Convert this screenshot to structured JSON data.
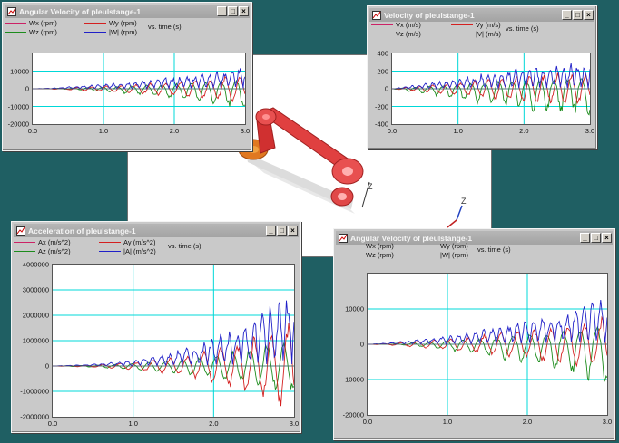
{
  "colors": {
    "x": "#cc2266",
    "y": "#d42020",
    "z": "#1c8c1c",
    "mag": "#2020c8",
    "grid": "#00d8d8",
    "zero": "#606060"
  },
  "icons": {
    "window": "chart-window-icon",
    "minimize": "minimize-icon",
    "maximize": "maximize-icon",
    "close": "close-icon"
  },
  "model": {
    "axis_z": "Z"
  },
  "windows": [
    {
      "id": "angvel-top",
      "title": "Angular Velocity of pleulstange-1",
      "legend": [
        "Wx (rpm)",
        "Wy (rpm)",
        "Wz (rpm)",
        "|W| (rpm)"
      ],
      "vs_label": "vs. time (s)",
      "yticks": [
        "10000",
        "0",
        "-10000",
        "-20000"
      ],
      "xticks": [
        "0.0",
        "1.0",
        "2.0",
        "3.0"
      ],
      "buttons": {
        "minimize": "_",
        "maximize": "□",
        "close": "×"
      },
      "chart_data": {
        "type": "line",
        "title": "Angular Velocity of pleulstange-1",
        "xlabel": "time (s)",
        "ylabel": "",
        "xlim": [
          0,
          3
        ],
        "ylim": [
          -20000,
          20000
        ],
        "grid": true,
        "series": [
          {
            "name": "Wx (rpm)",
            "values_desc": ""
          },
          {
            "name": "Wy (rpm)"
          },
          {
            "name": "Wz (rpm)",
            "values": [
              0,
              0,
              -500,
              -1500,
              -2500,
              -3500,
              -5000,
              -6500,
              -8000,
              -10000,
              -11500,
              -13000
            ],
            "x": [
              0,
              0.3,
              0.6,
              0.9,
              1.2,
              1.5,
              1.8,
              2.1,
              2.4,
              2.6,
              2.8,
              3.0
            ]
          },
          {
            "name": "|W| (rpm)",
            "values": [
              0,
              500,
              1500,
              2500,
              3500,
              5000,
              6500,
              8000,
              9500,
              11000,
              12500,
              14000
            ],
            "x": [
              0,
              0.3,
              0.6,
              0.9,
              1.2,
              1.5,
              1.8,
              2.1,
              2.4,
              2.6,
              2.8,
              3.0
            ]
          }
        ]
      }
    },
    {
      "id": "vel-top",
      "title": "Velocity of pleulstange-1",
      "legend": [
        "Vx (m/s)",
        "Vy (m/s)",
        "Vz (m/s)",
        "|V| (m/s)"
      ],
      "vs_label": "vs. time (s)",
      "yticks": [
        "400",
        "200",
        "0",
        "-200",
        "-400"
      ],
      "xticks": [
        "0.0",
        "1.0",
        "2.0",
        "3.0"
      ],
      "buttons": {
        "minimize": "_",
        "maximize": "□",
        "close": "×"
      },
      "chart_data": {
        "type": "line",
        "title": "Velocity of pleulstange-1",
        "xlabel": "time (s)",
        "ylabel": "",
        "xlim": [
          0,
          3
        ],
        "ylim": [
          -400,
          400
        ],
        "grid": true,
        "series": [
          {
            "name": "Vx (m/s)"
          },
          {
            "name": "Vy (m/s)",
            "values": [
              0,
              -40,
              -80,
              -120,
              -160,
              -200,
              -240,
              -270,
              -300,
              -320
            ],
            "x": [
              0,
              0.3,
              0.6,
              0.9,
              1.2,
              1.5,
              1.8,
              2.1,
              2.5,
              3.0
            ]
          },
          {
            "name": "Vz (m/s)",
            "values": [
              0,
              -30,
              -60,
              -100,
              -140,
              -170,
              -200,
              -230,
              -260,
              -280
            ],
            "x": [
              0,
              0.3,
              0.6,
              0.9,
              1.2,
              1.5,
              1.8,
              2.1,
              2.5,
              3.0
            ]
          },
          {
            "name": "|V| (m/s)",
            "values": [
              0,
              40,
              80,
              120,
              160,
              200,
              240,
              270,
              300,
              320
            ],
            "x": [
              0,
              0.3,
              0.6,
              0.9,
              1.2,
              1.5,
              1.8,
              2.1,
              2.5,
              3.0
            ]
          }
        ]
      }
    },
    {
      "id": "acc-bottom",
      "title": "Acceleration of pleulstange-1",
      "legend": [
        "Ax (m/s^2)",
        "Ay (m/s^2)",
        "Az (m/s^2)",
        "|A| (m/s^2)"
      ],
      "vs_label": "vs. time (s)",
      "yticks": [
        "4000000",
        "3000000",
        "2000000",
        "1000000",
        "0",
        "-1000000",
        "-2000000"
      ],
      "xticks": [
        "0.0",
        "1.0",
        "2.0",
        "3.0"
      ],
      "buttons": {
        "minimize": "_",
        "maximize": "□",
        "close": "×"
      },
      "chart_data": {
        "type": "line",
        "title": "Acceleration of pleulstange-1",
        "xlabel": "time (s)",
        "ylabel": "",
        "xlim": [
          0,
          3
        ],
        "ylim": [
          -2000000,
          4000000
        ],
        "grid": true,
        "series": [
          {
            "name": "Ax (m/s^2)"
          },
          {
            "name": "Ay (m/s^2)",
            "values": [
              0,
              -50000,
              -150000,
              -300000,
              -500000,
              -700000,
              -900000,
              -1100000
            ],
            "x": [
              0,
              0.5,
              1.0,
              1.5,
              2.0,
              2.4,
              2.7,
              3.0
            ]
          },
          {
            "name": "Az (m/s^2)",
            "values": [
              0,
              -50000,
              -150000,
              -300000,
              -550000,
              -800000,
              -1000000,
              -1200000
            ],
            "x": [
              0,
              0.5,
              1.0,
              1.5,
              2.0,
              2.4,
              2.7,
              3.0
            ]
          },
          {
            "name": "|A| (m/s^2)",
            "values": [
              0,
              80000,
              250000,
              600000,
              1200000,
              1900000,
              2600000,
              3400000
            ],
            "x": [
              0,
              0.5,
              1.0,
              1.5,
              2.0,
              2.4,
              2.7,
              3.0
            ]
          }
        ]
      }
    },
    {
      "id": "angvel-bottom",
      "title": "Angular Velocity of pleulstange-1",
      "legend": [
        "Wx (rpm)",
        "Wy (rpm)",
        "Wz (rpm)",
        "|W| (rpm)"
      ],
      "vs_label": "vs. time (s)",
      "yticks": [
        "10000",
        "0",
        "-10000",
        "-20000"
      ],
      "xticks": [
        "0.0",
        "1.0",
        "2.0",
        "3.0"
      ],
      "buttons": {
        "minimize": "_",
        "maximize": "□",
        "close": "×"
      },
      "chart_data": {
        "type": "line",
        "title": "Angular Velocity of pleulstange-1",
        "xlabel": "time (s)",
        "ylabel": "",
        "xlim": [
          0,
          3
        ],
        "ylim": [
          -20000,
          20000
        ],
        "grid": true,
        "series": [
          {
            "name": "Wx (rpm)"
          },
          {
            "name": "Wy (rpm)"
          },
          {
            "name": "Wz (rpm)",
            "values": [
              0,
              0,
              -500,
              -1500,
              -2500,
              -3500,
              -5000,
              -6500,
              -8000,
              -10000,
              -11500,
              -13000
            ],
            "x": [
              0,
              0.3,
              0.6,
              0.9,
              1.2,
              1.5,
              1.8,
              2.1,
              2.4,
              2.6,
              2.8,
              3.0
            ]
          },
          {
            "name": "|W| (rpm)",
            "values": [
              0,
              500,
              1500,
              2500,
              3500,
              5000,
              6500,
              8000,
              9500,
              11000,
              12500,
              14000
            ],
            "x": [
              0,
              0.3,
              0.6,
              0.9,
              1.2,
              1.5,
              1.8,
              2.1,
              2.4,
              2.6,
              2.8,
              3.0
            ]
          }
        ]
      }
    }
  ]
}
